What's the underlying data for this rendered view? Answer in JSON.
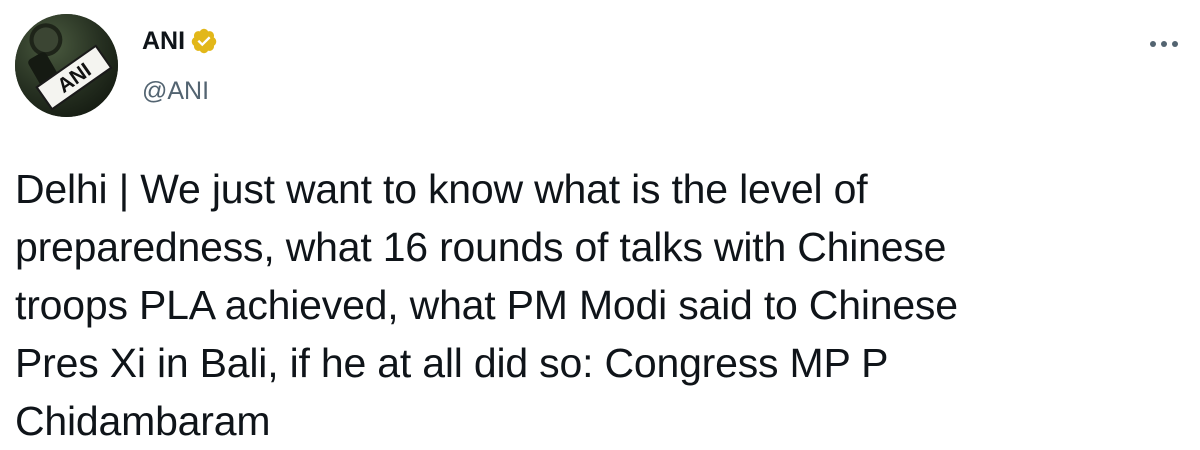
{
  "author": {
    "display_name": "ANI",
    "handle": "@ANI",
    "verified_badge": "verified-gold-check-icon",
    "verified_color": "#e2b719",
    "avatar_logo_text": "ANI"
  },
  "menu": {
    "more_icon": "more-dots-icon"
  },
  "tweet": {
    "text": "Delhi | We just want to know what is the level of\npreparedness, what 16 rounds of talks with Chinese\ntroops PLA achieved, what PM Modi said to Chinese\nPres Xi in Bali, if he at all did so: Congress MP P\nChidambaram"
  },
  "colors": {
    "text": "#0f1419",
    "secondary": "#536471",
    "background": "#ffffff"
  }
}
